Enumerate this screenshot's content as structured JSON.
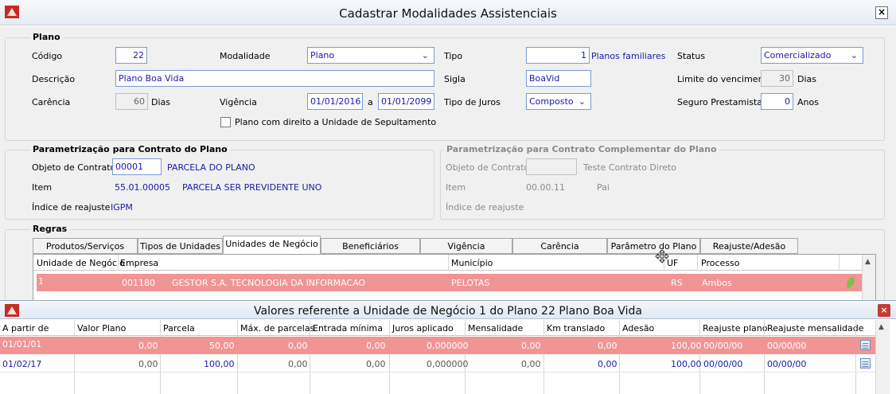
{
  "window": {
    "title": "Cadastrar Modalidades Assistenciais",
    "close": "×"
  },
  "plano": {
    "legend": "Plano",
    "codigo_label": "Código",
    "codigo": "22",
    "modalidade_label": "Modalidade",
    "modalidade": "Plano",
    "tipo_label": "Tipo",
    "tipo": "1",
    "tipo_desc": "Planos familiares",
    "status_label": "Status",
    "status": "Comercializado",
    "descricao_label": "Descrição",
    "descricao": "Plano Boa Vida",
    "sigla_label": "Sigla",
    "sigla": "BoaVid",
    "limite_label": "Limite do vencimento",
    "limite": "30",
    "limite_unit": "Dias",
    "carencia_label": "Carência",
    "carencia": "60",
    "carencia_unit": "Dias",
    "vigencia_label": "Vigência",
    "vigencia_inicio": "01/01/2016",
    "vigencia_sep": "a",
    "vigencia_fim": "01/01/2099",
    "juros_label": "Tipo de Juros",
    "juros": "Composto",
    "seguro_label": "Seguro Prestamista",
    "seguro": "0",
    "seguro_unit": "Anos",
    "sepultamento_label": "Plano com direito a Unidade de Sepultamento"
  },
  "param_contrato": {
    "legend": "Parametrização para Contrato do Plano",
    "objeto_label": "Objeto de Contrato",
    "objeto_code": "00001",
    "objeto_desc": "PARCELA DO PLANO",
    "item_label": "Item",
    "item_code": "55.01.00005",
    "item_desc": "PARCELA SER PREVIDENTE UNO",
    "indice_label": "Índice de reajuste",
    "indice": "IGPM"
  },
  "param_complementar": {
    "legend": "Parametrização para Contrato Complementar do Plano",
    "objeto_label": "Objeto de Contrato",
    "objeto_code": "",
    "objeto_desc": "Teste Contrato Direto",
    "item_label": "Item",
    "item_code": "00.00.11",
    "item_desc": "Pai",
    "indice_label": "Índice de reajuste"
  },
  "regras": {
    "legend": "Regras",
    "tabs": [
      {
        "label": "Produtos/Serviços"
      },
      {
        "label": "Tipos de Unidades"
      },
      {
        "label": "Unidades de Negócio"
      },
      {
        "label": "Beneficiários"
      },
      {
        "label": "Vigência"
      },
      {
        "label": "Carência"
      },
      {
        "label": "Parâmetro do Plano"
      },
      {
        "label": "Reajuste/Adesão"
      }
    ],
    "columns": [
      "Unidade de Negócio",
      "Empresa",
      "Município",
      "UF",
      "Processo"
    ],
    "rows": [
      {
        "unidade": "1",
        "empresa_code": "001180",
        "empresa": "GESTOR S.A. TECNOLOGIA DA INFORMACAO",
        "municipio": "PELOTAS",
        "uf": "RS",
        "processo": "Ambos"
      }
    ]
  },
  "valores": {
    "title": "Valores referente a Unidade de Negócio 1   do Plano 22 Plano Boa Vida",
    "columns": [
      "A partir de",
      "Valor Plano",
      "Parcela",
      "Máx. de parcelas",
      "Entrada mínima",
      "Juros aplicado",
      "Mensalidade",
      "Km translado",
      "Adesão",
      "Reajuste plano",
      "Reajuste mensalidade"
    ],
    "rows": [
      {
        "a_partir": "01/01/01",
        "valor_plano": "0,00",
        "parcela": "50,00",
        "max_parcelas": "0,00",
        "entrada": "0,00",
        "juros": "0,000000",
        "mensalidade": "0,00",
        "km": "0,00",
        "adesao": "100,00",
        "reaj_plano": "00/00/00",
        "reaj_mens": "00/00/00"
      },
      {
        "a_partir": "01/02/17",
        "valor_plano": "0,00",
        "parcela": "100,00",
        "max_parcelas": "0,00",
        "entrada": "0,00",
        "juros": "0,000000",
        "mensalidade": "0,00",
        "km": "0,00",
        "adesao": "100,00",
        "reaj_plano": "00/00/00",
        "reaj_mens": "00/00/00"
      }
    ]
  },
  "colors": {
    "selected_row": "#f19494",
    "value_text": "#1a1aa8",
    "input_border": "#7a9cd3"
  },
  "icons": [
    "app-icon",
    "close-icon",
    "chevron-down-icon",
    "checkbox-icon",
    "leaf-icon",
    "note-icon",
    "scroll-up-icon",
    "move-cursor-icon"
  ]
}
